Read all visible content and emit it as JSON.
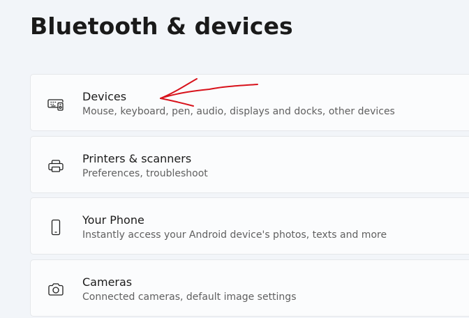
{
  "page": {
    "title": "Bluetooth & devices"
  },
  "cards": [
    {
      "title": "Devices",
      "subtitle": "Mouse, keyboard, pen, audio, displays and docks, other devices",
      "icon": "devices-icon"
    },
    {
      "title": "Printers & scanners",
      "subtitle": "Preferences, troubleshoot",
      "icon": "printer-icon"
    },
    {
      "title": "Your Phone",
      "subtitle": "Instantly access your Android device's photos, texts and more",
      "icon": "phone-icon"
    },
    {
      "title": "Cameras",
      "subtitle": "Connected cameras, default image settings",
      "icon": "camera-icon"
    }
  ],
  "colors": {
    "background": "#f2f5f9",
    "card": "#fbfcfd",
    "card_border": "#e5e7ea",
    "annotation": "#d8121b"
  }
}
